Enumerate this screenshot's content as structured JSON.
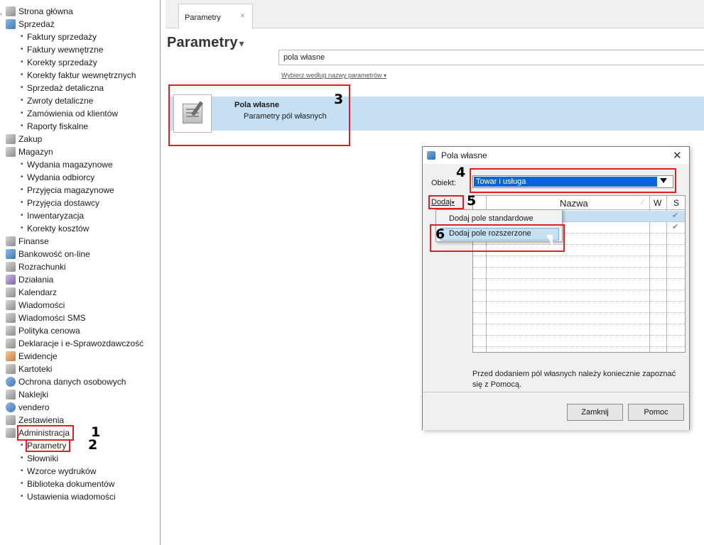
{
  "sidebar": {
    "items": [
      {
        "label": "Strona główna",
        "type": "module",
        "icon": "home-icon",
        "color": "grey"
      },
      {
        "label": "Sprzedaż",
        "type": "module",
        "icon": "sales-icon",
        "color": "blue"
      },
      {
        "label": "Faktury sprzedaży",
        "type": "sub"
      },
      {
        "label": "Faktury wewnętrzne",
        "type": "sub"
      },
      {
        "label": "Korekty sprzedaży",
        "type": "sub"
      },
      {
        "label": "Korekty faktur wewnętrznych",
        "type": "sub"
      },
      {
        "label": "Sprzedaż detaliczna",
        "type": "sub"
      },
      {
        "label": "Zwroty detaliczne",
        "type": "sub"
      },
      {
        "label": "Zamówienia od klientów",
        "type": "sub"
      },
      {
        "label": "Raporty fiskalne",
        "type": "sub"
      },
      {
        "label": "Zakup",
        "type": "module",
        "icon": "purchase-icon",
        "color": "grey"
      },
      {
        "label": "Magazyn",
        "type": "module",
        "icon": "warehouse-icon",
        "color": "grey"
      },
      {
        "label": "Wydania magazynowe",
        "type": "sub"
      },
      {
        "label": "Wydania odbiorcy",
        "type": "sub"
      },
      {
        "label": "Przyjęcia magazynowe",
        "type": "sub"
      },
      {
        "label": "Przyjęcia dostawcy",
        "type": "sub"
      },
      {
        "label": "Inwentaryzacja",
        "type": "sub"
      },
      {
        "label": "Korekty kosztów",
        "type": "sub"
      },
      {
        "label": "Finanse",
        "type": "module",
        "icon": "finance-icon",
        "color": "grey"
      },
      {
        "label": "Bankowość on-line",
        "type": "module",
        "icon": "bank-icon",
        "color": "blue"
      },
      {
        "label": "Rozrachunki",
        "type": "module",
        "icon": "settlements-icon",
        "color": "grey"
      },
      {
        "label": "Działania",
        "type": "module",
        "icon": "actions-icon",
        "color": "purple"
      },
      {
        "label": "Kalendarz",
        "type": "module",
        "icon": "calendar-icon",
        "color": "grey"
      },
      {
        "label": "Wiadomości",
        "type": "module",
        "icon": "messages-icon",
        "color": "grey"
      },
      {
        "label": "Wiadomości SMS",
        "type": "module",
        "icon": "sms-icon",
        "color": "grey"
      },
      {
        "label": "Polityka cenowa",
        "type": "module",
        "icon": "pricing-icon",
        "color": "grey"
      },
      {
        "label": "Deklaracje i e-Sprawozdawczość",
        "type": "module",
        "icon": "declarations-icon",
        "color": "grey"
      },
      {
        "label": "Ewidencje",
        "type": "module",
        "icon": "records-icon",
        "color": "orange"
      },
      {
        "label": "Kartoteki",
        "type": "module",
        "icon": "files-icon",
        "color": "grey"
      },
      {
        "label": "Ochrona danych osobowych",
        "type": "module",
        "icon": "privacy-icon",
        "color": "blue",
        "round": true
      },
      {
        "label": "Naklejki",
        "type": "module",
        "icon": "stickers-icon",
        "color": "grey"
      },
      {
        "label": "vendero",
        "type": "module",
        "icon": "vendero-icon",
        "color": "blue",
        "round": true
      },
      {
        "label": "Zestawienia",
        "type": "module",
        "icon": "reports-icon",
        "color": "grey"
      },
      {
        "label": "Administracja",
        "type": "module",
        "icon": "admin-icon",
        "color": "grey",
        "highlight": true,
        "mark": "1"
      },
      {
        "label": "Parametry",
        "type": "sub",
        "highlight": true,
        "mark": "2"
      },
      {
        "label": "Słowniki",
        "type": "sub"
      },
      {
        "label": "Wzorce wydruków",
        "type": "sub"
      },
      {
        "label": "Biblioteka dokumentów",
        "type": "sub"
      },
      {
        "label": "Ustawienia wiadomości",
        "type": "sub"
      }
    ]
  },
  "tabbar": {
    "tab_label": "Parametry",
    "tab_close": "×"
  },
  "main": {
    "title": "Parametry",
    "title_caret": "▾",
    "search_value": "pola własne",
    "search_hint": "Wybierz według nazwy parametrów",
    "search_hint_caret": "▾",
    "result": {
      "title": "Pola własne",
      "subtitle": "Parametry pól własnych",
      "mark": "3"
    }
  },
  "dialog": {
    "title": "Pola własne",
    "close": "✕",
    "obiekt_label": "Obiekt:",
    "obiekt_value": "Towar i usługa",
    "obiekt_mark": "4",
    "dodaj_label": "Dodaj",
    "dodaj_caret": "▾",
    "dodaj_mark": "5",
    "columns": {
      "nazwa": "Nazwa",
      "w": "W",
      "s": "S",
      "sort": "∕"
    },
    "menu": {
      "item1": "Dodaj pole standardowe",
      "item2": "Dodaj pole rozszerzone",
      "mark": "6"
    },
    "checkmark": "✔",
    "help_note": "Przed dodaniem pól własnych należy koniecznie zapoznać się z Pomocą.",
    "buttons": {
      "close": "Zamknij",
      "help": "Pomoc"
    }
  },
  "colors": {
    "highlight_red": "#e02020",
    "selection_blue": "#c6e0f3",
    "select_blue": "#0a64d8"
  }
}
